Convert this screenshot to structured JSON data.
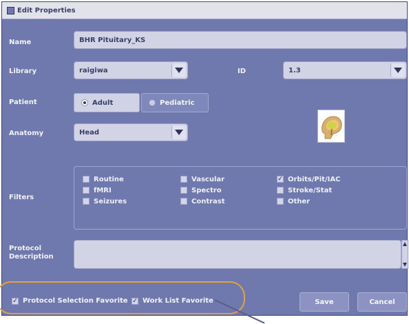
{
  "window": {
    "title": "Edit Properties"
  },
  "labels": {
    "name": "Name",
    "library": "Library",
    "id": "ID",
    "patient": "Patient",
    "anatomy": "Anatomy",
    "filters": "Filters",
    "protocol_description_line1": "Protocol",
    "protocol_description_line2": "Description"
  },
  "fields": {
    "name_value": "BHR Pituitary_KS",
    "library_value": "raigiwa",
    "id_value": "1.3",
    "anatomy_value": "Head",
    "protocol_description_value": ""
  },
  "patient": {
    "options": [
      {
        "label": "Adult",
        "selected": true
      },
      {
        "label": "Pediatric",
        "selected": false
      }
    ]
  },
  "filters": {
    "items": [
      {
        "label": "Routine",
        "checked": false
      },
      {
        "label": "fMRI",
        "checked": false
      },
      {
        "label": "Seizures",
        "checked": false
      },
      {
        "label": "Vascular",
        "checked": false
      },
      {
        "label": "Spectro",
        "checked": false
      },
      {
        "label": "Contrast",
        "checked": false
      },
      {
        "label": "Orbits/Pit/IAC",
        "checked": true
      },
      {
        "label": "Stroke/Stat",
        "checked": false
      },
      {
        "label": "Other",
        "checked": false
      }
    ]
  },
  "favorites": {
    "protocol_selection": {
      "label": "Protocol Selection Favorite",
      "checked": true
    },
    "work_list": {
      "label": "Work List Favorite",
      "checked": true
    }
  },
  "buttons": {
    "save": "Save",
    "cancel": "Cancel"
  },
  "icons": {
    "title": "window-icon",
    "dropdown": "triangle-down-icon",
    "anatomy": "head-anatomy-icon",
    "check": "✓"
  },
  "colors": {
    "panel": "#6f79ad",
    "field": "#d2d4e6",
    "highlight": "#e6a23a"
  }
}
